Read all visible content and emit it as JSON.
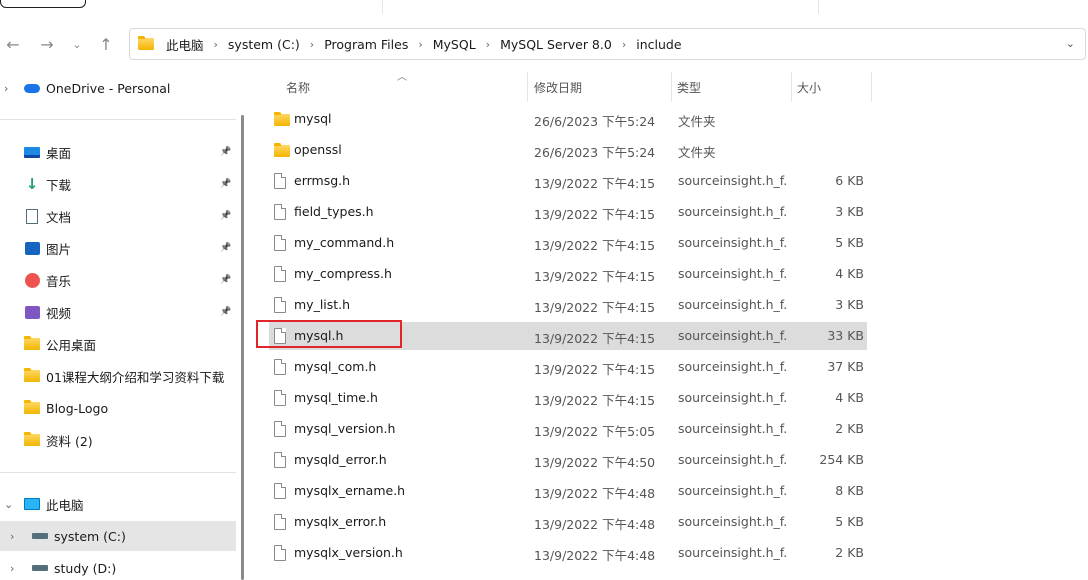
{
  "nav": {
    "back_icon": "arrow-left-icon",
    "forward_icon": "arrow-right-icon",
    "recent_icon": "chevron-down-icon",
    "up_icon": "arrow-up-icon"
  },
  "address": {
    "crumbs": [
      "此电脑",
      "system (C:)",
      "Program Files",
      "MySQL",
      "MySQL Server 8.0",
      "include"
    ]
  },
  "sidebar": {
    "onedrive": "OneDrive - Personal",
    "quick": [
      {
        "label": "桌面",
        "icon": "desktop-icon",
        "pinned": true
      },
      {
        "label": "下载",
        "icon": "download-icon",
        "pinned": true
      },
      {
        "label": "文档",
        "icon": "documents-icon",
        "pinned": true
      },
      {
        "label": "图片",
        "icon": "pictures-icon",
        "pinned": true
      },
      {
        "label": "音乐",
        "icon": "music-icon",
        "pinned": true
      },
      {
        "label": "视频",
        "icon": "videos-icon",
        "pinned": true
      },
      {
        "label": "公用桌面",
        "icon": "folder-icon",
        "pinned": false
      },
      {
        "label": "01课程大纲介绍和学习资料下载",
        "icon": "folder-icon",
        "pinned": false
      },
      {
        "label": "Blog-Logo",
        "icon": "folder-icon",
        "pinned": false
      },
      {
        "label": "资料 (2)",
        "icon": "folder-icon",
        "pinned": false
      }
    ],
    "this_pc": "此电脑",
    "drives": [
      {
        "label": "system (C:)",
        "selected": true
      },
      {
        "label": "study (D:)",
        "selected": false
      }
    ]
  },
  "columns": {
    "name": "名称",
    "date": "修改日期",
    "type": "类型",
    "size": "大小"
  },
  "files": [
    {
      "name": "mysql",
      "date": "26/6/2023 下午5:24",
      "type": "文件夹",
      "size": "",
      "kind": "folder"
    },
    {
      "name": "openssl",
      "date": "26/6/2023 下午5:24",
      "type": "文件夹",
      "size": "",
      "kind": "folder"
    },
    {
      "name": "errmsg.h",
      "date": "13/9/2022 下午4:15",
      "type": "sourceinsight.h_f...",
      "size": "6 KB",
      "kind": "file"
    },
    {
      "name": "field_types.h",
      "date": "13/9/2022 下午4:15",
      "type": "sourceinsight.h_f...",
      "size": "3 KB",
      "kind": "file"
    },
    {
      "name": "my_command.h",
      "date": "13/9/2022 下午4:15",
      "type": "sourceinsight.h_f...",
      "size": "5 KB",
      "kind": "file"
    },
    {
      "name": "my_compress.h",
      "date": "13/9/2022 下午4:15",
      "type": "sourceinsight.h_f...",
      "size": "4 KB",
      "kind": "file"
    },
    {
      "name": "my_list.h",
      "date": "13/9/2022 下午4:15",
      "type": "sourceinsight.h_f...",
      "size": "3 KB",
      "kind": "file"
    },
    {
      "name": "mysql.h",
      "date": "13/9/2022 下午4:15",
      "type": "sourceinsight.h_f...",
      "size": "33 KB",
      "kind": "file",
      "selected": true
    },
    {
      "name": "mysql_com.h",
      "date": "13/9/2022 下午4:15",
      "type": "sourceinsight.h_f...",
      "size": "37 KB",
      "kind": "file"
    },
    {
      "name": "mysql_time.h",
      "date": "13/9/2022 下午4:15",
      "type": "sourceinsight.h_f...",
      "size": "4 KB",
      "kind": "file"
    },
    {
      "name": "mysql_version.h",
      "date": "13/9/2022 下午5:05",
      "type": "sourceinsight.h_f...",
      "size": "2 KB",
      "kind": "file"
    },
    {
      "name": "mysqld_error.h",
      "date": "13/9/2022 下午4:50",
      "type": "sourceinsight.h_f...",
      "size": "254 KB",
      "kind": "file"
    },
    {
      "name": "mysqlx_ername.h",
      "date": "13/9/2022 下午4:48",
      "type": "sourceinsight.h_f...",
      "size": "8 KB",
      "kind": "file"
    },
    {
      "name": "mysqlx_error.h",
      "date": "13/9/2022 下午4:48",
      "type": "sourceinsight.h_f...",
      "size": "5 KB",
      "kind": "file"
    },
    {
      "name": "mysqlx_version.h",
      "date": "13/9/2022 下午4:48",
      "type": "sourceinsight.h_f...",
      "size": "2 KB",
      "kind": "file"
    }
  ],
  "colors": {
    "selection": "#dcdcdc",
    "highlight_box": "#e0262b",
    "folder": "#f4b400"
  }
}
